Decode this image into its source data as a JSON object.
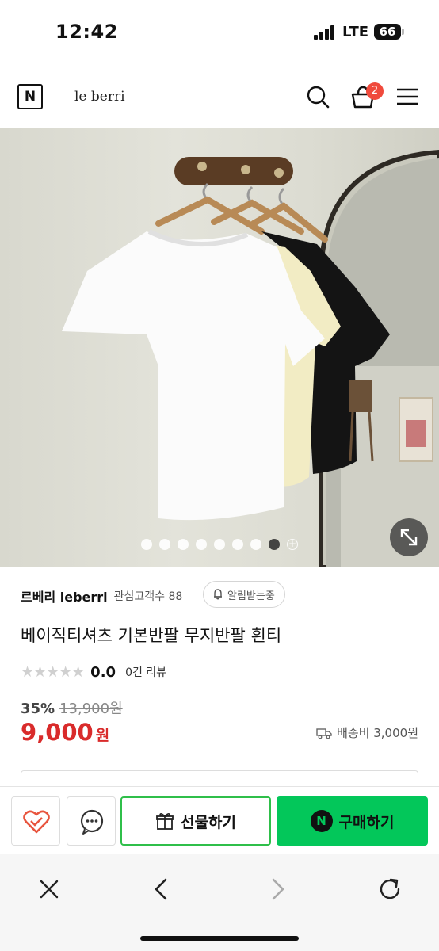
{
  "status_bar": {
    "time": "12:42",
    "network": "LTE",
    "battery": "66"
  },
  "header": {
    "logo_letter": "N",
    "brand": "le berri",
    "icons": [
      "search-icon",
      "cart-icon",
      "menu-icon"
    ],
    "cart_count": "2"
  },
  "gallery": {
    "image_description_icon": "product-photo",
    "total_dots": 8,
    "active_index": 8,
    "more_icon": "plus-circle-icon",
    "expand_icon": "expand-icon"
  },
  "seller": {
    "name": "르베리 leberri",
    "fans": "관심고객수 88",
    "alarm_label": "알림받는중"
  },
  "product": {
    "title": "베이직티셔츠 기본반팔 무지반팔 흰티",
    "stars": "★★★★★",
    "rating": "0.0",
    "reviews": "0건 리뷰",
    "discount": "35%",
    "original_price": "13,900원",
    "price": "9,000",
    "price_unit": "원",
    "shipping": "배송비 3,000원"
  },
  "buy_bar": {
    "gift_label": "선물하기",
    "buy_label": "구매하기",
    "npay_letter": "N"
  },
  "colors": {
    "price_red": "#d92b2b",
    "naver_green": "#03c75a",
    "badge_red": "#f04a3c"
  }
}
